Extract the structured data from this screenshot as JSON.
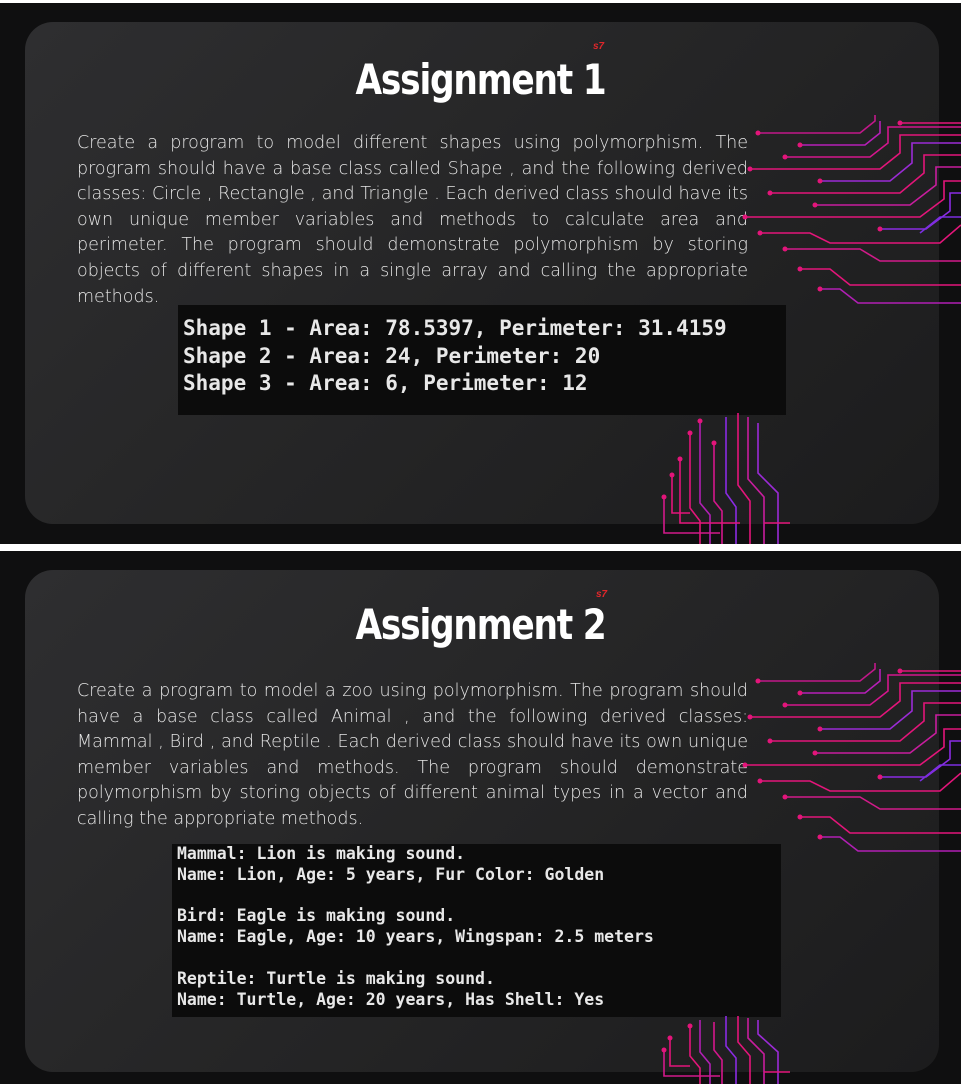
{
  "slides": [
    {
      "badge": "s7",
      "title": "Assignment 1",
      "description": "Create a program to model different shapes using polymorphism. The program should have a base class called Shape , and the following derived classes: Circle , Rectangle , and Triangle . Each derived class should have its own unique member variables and methods to calculate area and perimeter. The program should demonstrate polymorphism by storing objects of different shapes in a single array and calling the appropriate methods.",
      "console_lines": [
        "Shape 1 - Area: 78.5397, Perimeter: 31.4159",
        "Shape 2 - Area: 24, Perimeter: 20",
        "Shape 3 - Area: 6, Perimeter: 12"
      ]
    },
    {
      "badge": "s7",
      "title": "Assignment 2",
      "description": "Create a program to model a zoo using polymorphism. The program should have a base class called Animal , and the following derived classes: Mammal , Bird , and Reptile . Each derived class should have its own unique member variables and methods. The program should demonstrate polymorphism by storing objects of different animal types in a vector and calling the appropriate methods.",
      "console_lines": [
        "Mammal: Lion is making sound.",
        "Name: Lion, Age: 5 years, Fur Color: Golden",
        "",
        "Bird: Eagle is making sound.",
        "Name: Eagle, Age: 10 years, Wingspan: 2.5 meters",
        "",
        "Reptile: Turtle is making sound.",
        "Name: Turtle, Age: 20 years, Has Shell: Yes"
      ]
    }
  ],
  "colors": {
    "circuit_pink": "#e3157a",
    "circuit_purple": "#8a2be2",
    "badge_red": "#e0262b"
  },
  "icons": [
    "circuit-decoration-right",
    "circuit-decoration-bottom"
  ]
}
